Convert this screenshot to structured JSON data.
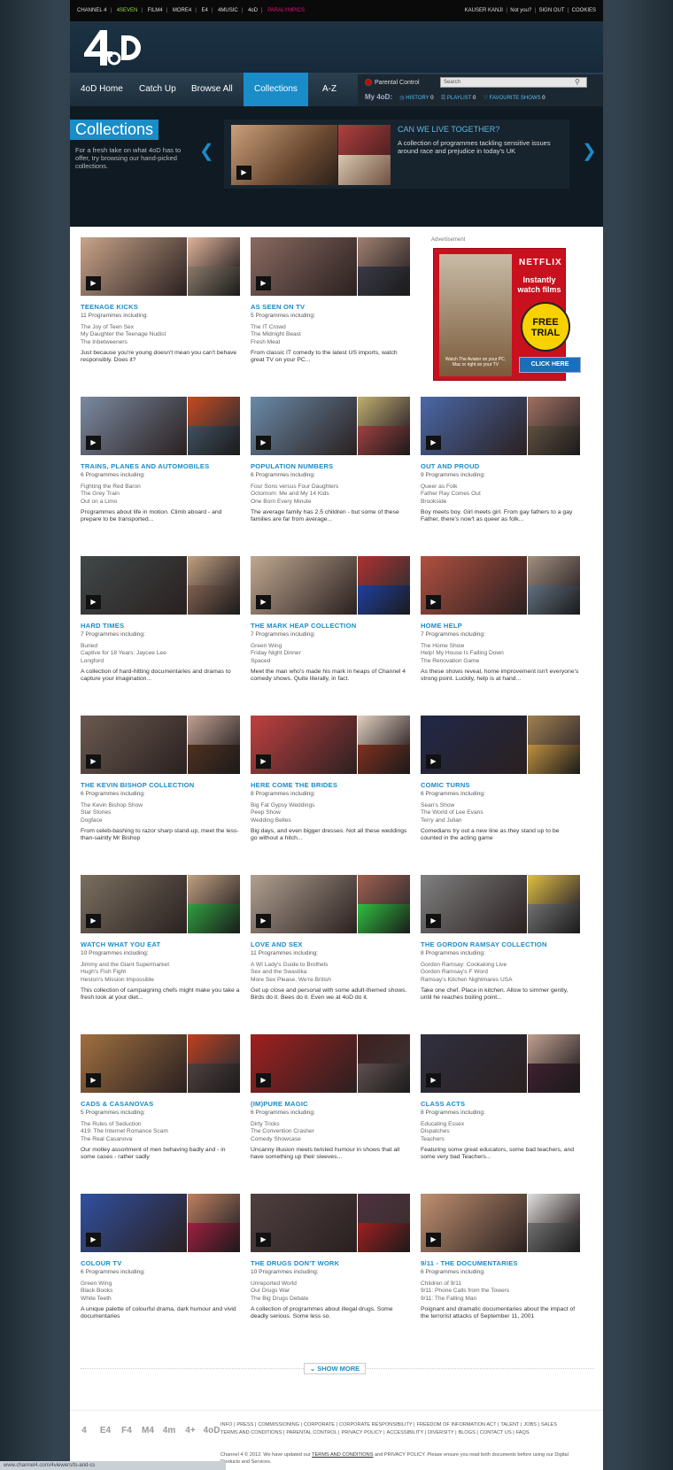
{
  "topbar": {
    "networks": [
      "CHANNEL 4",
      "4SEVEN",
      "FILM4",
      "MORE4",
      "E4",
      "4MUSIC",
      "4oD",
      "PARALYMPICS"
    ],
    "user_name": "KAUSER KANJI",
    "not_you": "Not you?",
    "sign_out": "SIGN OUT",
    "cookies": "COOKIES"
  },
  "nav": {
    "items": [
      "4oD Home",
      "Catch Up",
      "Browse All",
      "Collections",
      "A-Z"
    ]
  },
  "parental_control": "Parental Control",
  "search_placeholder": "Search",
  "my4od": {
    "label": "My 4oD:",
    "history": "HISTORY",
    "history_count": "0",
    "playlist": "PLAYLIST",
    "playlist_count": "0",
    "favourites": "FAVOURITE SHOWS",
    "favourites_count": "0"
  },
  "hero": {
    "title": "Collections",
    "description": "For a fresh take on what 4oD has to offer, try browsing our hand-picked collections.",
    "slide_title": "CAN WE LIVE TOGETHER?",
    "slide_description": "A collection of programmes tackling sensitive issues around race and prejudice in today's UK"
  },
  "ad": {
    "label": "Advertisement",
    "brand": "NETFLIX",
    "headline": "Instantly watch films",
    "badge": "FREE TRIAL",
    "caption": "Watch The Aviator on your PC, Mac or right on your TV",
    "button": "CLICK HERE"
  },
  "cards": [
    {
      "title": "TEENAGE KICKS",
      "count": "11 Programmes including:",
      "programmes": [
        "The Joy of Teen Sex",
        "My Daughter the Teenage Nudist",
        "The Inbetweeners"
      ],
      "description": "Just because you're young doesn't mean you can't behave responsibly. Does it?"
    },
    {
      "title": "AS SEEN ON TV",
      "count": "5 Programmes including:",
      "programmes": [
        "The IT Crowd",
        "The Midnight Beast",
        "Fresh Meat"
      ],
      "description": "From classic IT comedy to the latest US imports, watch great TV on your PC..."
    },
    {
      "title": "TRAINS, PLANES AND AUTOMOBILES",
      "count": "6 Programmes including:",
      "programmes": [
        "Fighting the Red Baron",
        "The Grey Train",
        "Out on a Limo"
      ],
      "description": "Programmes about life in motion. Climb aboard - and prepare to be transported..."
    },
    {
      "title": "POPULATION NUMBERS",
      "count": "6 Programmes including:",
      "programmes": [
        "Four Sons versus Four Daughters",
        "Octomom: Me and My 14 Kids",
        "One Born Every Minute"
      ],
      "description": "The average family has 2.5 children - but some of these families are far from average..."
    },
    {
      "title": "OUT AND PROUD",
      "count": "9 Programmes including:",
      "programmes": [
        "Queer as Folk",
        "Father Ray Comes Out",
        "Brookside"
      ],
      "description": "Boy meets boy. Girl meets girl. From gay fathers to a gay Father, there's now't as queer as folk..."
    },
    {
      "title": "HARD TIMES",
      "count": "7 Programmes including:",
      "programmes": [
        "Buried",
        "Captive for 18 Years: Jaycee Lee",
        "Longford"
      ],
      "description": "A collection of hard-hitting documentaries and dramas to capture your imagination..."
    },
    {
      "title": "THE MARK HEAP COLLECTION",
      "count": "7 Programmes including:",
      "programmes": [
        "Green Wing",
        "Friday Night Dinner",
        "Spaced"
      ],
      "description": "Meet the man who's made his mark in heaps of Channel 4 comedy shows. Quite literally, in fact."
    },
    {
      "title": "HOME HELP",
      "count": "7 Programmes including:",
      "programmes": [
        "The Home Show",
        "Help! My House Is Falling Down",
        "The Renovation Game"
      ],
      "description": "As these shows reveal, home improvement isn't everyone's strong point. Luckily, help is at hand..."
    },
    {
      "title": "THE KEVIN BISHOP COLLECTION",
      "count": "6 Programmes including:",
      "programmes": [
        "The Kevin Bishop Show",
        "Star Stories",
        "Dogface"
      ],
      "description": "From celeb-bashing to razor sharp stand-up, meet the less-than-saintly Mr Bishop"
    },
    {
      "title": "HERE COME THE BRIDES",
      "count": "8 Programmes including:",
      "programmes": [
        "Big Fat Gypsy Weddings",
        "Peep Show",
        "Wedding Belles"
      ],
      "description": "Big days, and even bigger dresses. Not all these weddings go without a hitch..."
    },
    {
      "title": "COMIC TURNS",
      "count": "6 Programmes including:",
      "programmes": [
        "Sean's Show",
        "The World of Lee Evans",
        "Terry and Julian"
      ],
      "description": "Comedians try out a new line as they stand up to be counted in the acting game"
    },
    {
      "title": "WATCH WHAT YOU EAT",
      "count": "10 Programmes including:",
      "programmes": [
        "Jimmy and the Giant Supermarket",
        "Hugh's Fish Fight",
        "Heston's Mission Impossible"
      ],
      "description": "This collection of campaigning chefs might make you take a fresh look at your diet..."
    },
    {
      "title": "LOVE AND SEX",
      "count": "11 Programmes including:",
      "programmes": [
        "A WI Lady's Guide to Brothels",
        "Sex and the Swastika",
        "More Sex Please, We're British"
      ],
      "description": "Get up close and personal with some adult-themed shows. Birds do it. Bees do it. Even we at 4oD do it."
    },
    {
      "title": "THE GORDON RAMSAY COLLECTION",
      "count": "8 Programmes including:",
      "programmes": [
        "Gordon Ramsay: Cookalong Live",
        "Gordon Ramsay's F Word",
        "Ramsay's Kitchen Nightmares USA"
      ],
      "description": "Take one chef. Place in kitchen. Allow to simmer gently, until he reaches boiling point..."
    },
    {
      "title": "CADS & CASANOVAS",
      "count": "5 Programmes including:",
      "programmes": [
        "The Rules of Seduction",
        "419: The Internet Romance Scam",
        "The Real Casanova"
      ],
      "description": "Our motley assortment of men behaving badly and - in some cases - rather sadly"
    },
    {
      "title": "(IM)PURE MAGIC",
      "count": "6 Programmes including:",
      "programmes": [
        "Dirty Tricks",
        "The Convention Crasher",
        "Comedy Showcase"
      ],
      "description": "Uncanny illusion meets twisted humour in shows that all have something up their sleeves..."
    },
    {
      "title": "CLASS ACTS",
      "count": "8 Programmes including:",
      "programmes": [
        "Educating Essex",
        "Dispatches",
        "Teachers"
      ],
      "description": "Featuring some great educators, some bad teachers, and some very bad Teachers..."
    },
    {
      "title": "COLOUR TV",
      "count": "6 Programmes including:",
      "programmes": [
        "Green Wing",
        "Black Books",
        "White Teeth"
      ],
      "description": "A unique palette of colourful drama, dark humour and vivid documentaries"
    },
    {
      "title": "THE DRUGS DON'T WORK",
      "count": "10 Programmes including:",
      "programmes": [
        "Unreported World",
        "Our Drugs War",
        "The Big Drugs Debate"
      ],
      "description": "A collection of programmes about illegal drugs. Some deadly serious. Some less so."
    },
    {
      "title": "9/11 - THE DOCUMENTARIES",
      "count": "6 Programmes including:",
      "programmes": [
        "Children of 9/11",
        "9/11: Phone Calls from the Towers",
        "9/11: The Falling Man"
      ],
      "description": "Poignant and dramatic documentaries about the impact of the terrorist attacks of September 11, 2001"
    }
  ],
  "show_more": "SHOW MORE",
  "footer": {
    "links_row1": [
      "INFO",
      "PRESS",
      "COMMISSIONING",
      "CORPORATE",
      "CORPORATE RESPONSIBILITY",
      "FREEDOM OF INFORMATION ACT",
      "TALENT",
      "JOBS",
      "SALES"
    ],
    "links_row2": [
      "TERMS AND CONDITIONS",
      "PARENTAL CONTROL",
      "PRIVACY POLICY",
      "ACCESSIBILITY",
      "DIVERSITY",
      "BLOGS",
      "CONTACT US",
      "FAQS"
    ],
    "copyright": "Channel 4 © 2012. We have updated our",
    "terms_link": "TERMS AND CONDITIONS",
    "copyright_rest": "and PRIVACY POLICY. Please ensure you read both documents before using our Digital Products and Services."
  },
  "status_url": "www.channel4.com/4viewers/ts-and-cs",
  "colors": {
    "accent": "#1a8cc8",
    "paralympics": "#e0127c",
    "foursevern": "#9bd84c"
  }
}
